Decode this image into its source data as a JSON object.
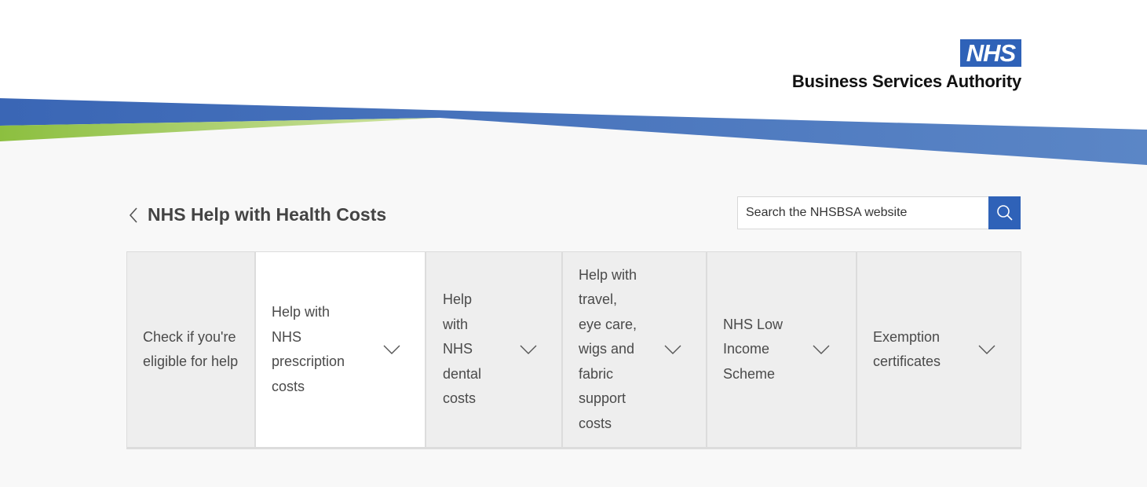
{
  "header": {
    "logo_mark": "NHS",
    "org_name": "Business Services Authority",
    "brand_colors": {
      "blue": "#2f62b8",
      "green": "#8cbf3f"
    }
  },
  "page": {
    "back_icon": "chevron-left-icon",
    "title": "NHS Help with Health Costs"
  },
  "search": {
    "placeholder": "Search the NHSBSA website",
    "value": "",
    "button_icon": "search-icon"
  },
  "tabs": [
    {
      "lines": [
        "Check if you're",
        "eligible for help"
      ],
      "active": false,
      "has_dropdown": false
    },
    {
      "lines": [
        "Help with",
        "NHS",
        "prescription",
        "costs"
      ],
      "active": true,
      "has_dropdown": true
    },
    {
      "lines": [
        "Help",
        "with",
        "NHS",
        "dental",
        "costs"
      ],
      "active": false,
      "has_dropdown": true
    },
    {
      "lines": [
        "Help with",
        "travel,",
        "eye care,",
        "wigs and",
        "fabric",
        "support",
        "costs"
      ],
      "active": false,
      "has_dropdown": true
    },
    {
      "lines": [
        "NHS Low",
        "Income",
        "Scheme"
      ],
      "active": false,
      "has_dropdown": true
    },
    {
      "lines": [
        "Exemption",
        "certificates"
      ],
      "active": false,
      "has_dropdown": true
    }
  ]
}
